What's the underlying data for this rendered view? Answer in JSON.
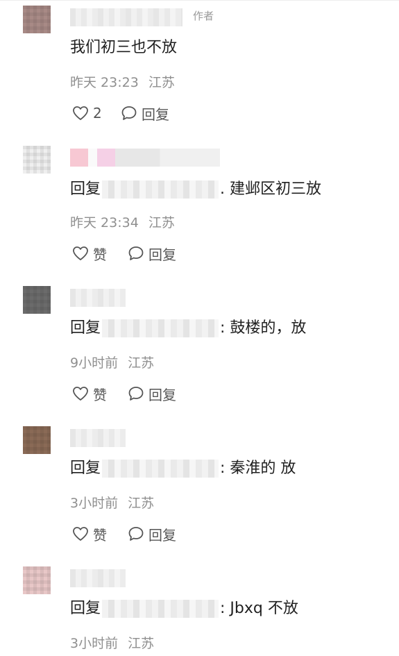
{
  "comments": [
    {
      "id": "c1",
      "author_tag": "作者",
      "text": "我们初三也不放",
      "meta": {
        "time": "昨天 23:23",
        "location": "江苏"
      },
      "like_label": "2",
      "reply_label": "回复"
    },
    {
      "id": "c2",
      "reply_prefix": "回复",
      "text": ". 建邺区初三放",
      "meta": {
        "time": "昨天 23:34",
        "location": "江苏"
      },
      "like_label": "赞",
      "reply_label": "回复"
    },
    {
      "id": "c3",
      "reply_prefix": "回复",
      "text": ": 鼓楼的，放",
      "meta": {
        "time": "9小时前",
        "location": "江苏"
      },
      "like_label": "赞",
      "reply_label": "回复"
    },
    {
      "id": "c4",
      "reply_prefix": "回复",
      "text": ": 秦淮的 放",
      "meta": {
        "time": "3小时前",
        "location": "江苏"
      },
      "like_label": "赞",
      "reply_label": "回复"
    },
    {
      "id": "c5",
      "reply_prefix": "回复",
      "text": ": Jbxq 不放",
      "meta": {
        "time": "3小时前",
        "location": "江苏"
      }
    }
  ],
  "icons": {
    "like": "heart-outline-icon",
    "reply": "comment-bubble-icon"
  },
  "colors": {
    "text": "#1f1f1f",
    "meta": "#8f8f8f",
    "action": "#555555"
  }
}
